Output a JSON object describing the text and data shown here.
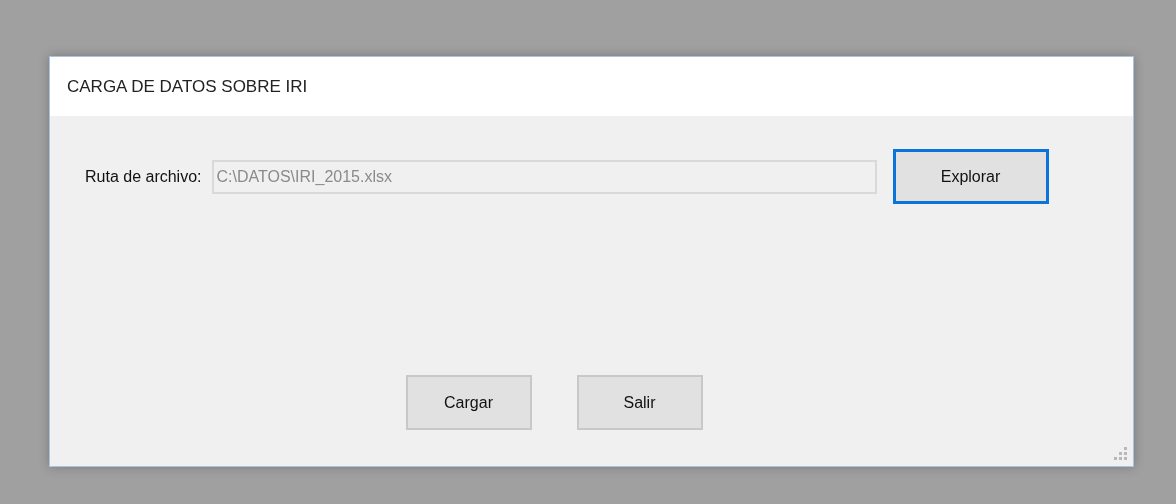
{
  "window": {
    "title": "CARGA DE DATOS SOBRE IRI"
  },
  "file_path": {
    "label": "Ruta de archivo:",
    "value": "C:\\DATOS\\IRI_2015.xlsx",
    "disabled": true
  },
  "browse_button": {
    "label": "Explorar",
    "focused": true
  },
  "buttons": [
    {
      "label": "Cargar",
      "focused": false
    },
    {
      "label": "Salir",
      "focused": false
    }
  ]
}
